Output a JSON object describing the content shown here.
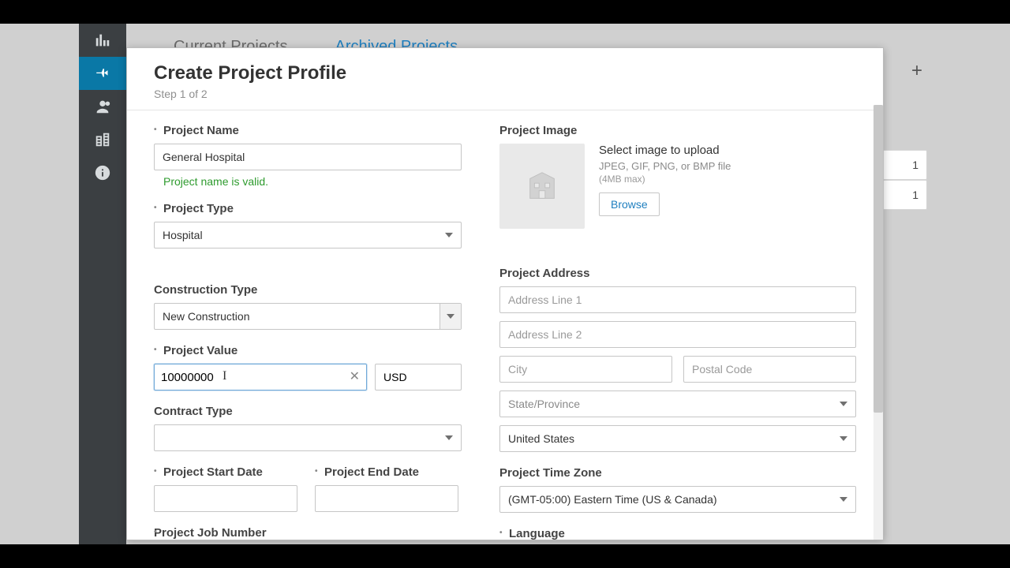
{
  "bg": {
    "tab_current": "Current Projects",
    "tab_archived": "Archived Projects",
    "card1": "1",
    "card2": "1"
  },
  "modal": {
    "title": "Create Project Profile",
    "subtitle": "Step 1 of 2"
  },
  "left": {
    "project_name_label": "Project Name",
    "project_name_value": "General Hospital",
    "project_name_valid": "Project name is valid.",
    "project_type_label": "Project Type",
    "project_type_value": "Hospital",
    "construction_type_label": "Construction Type",
    "construction_type_value": "New Construction",
    "project_value_label": "Project Value",
    "project_value_value": "10000000",
    "project_value_currency": "USD",
    "contract_type_label": "Contract Type",
    "contract_type_value": "",
    "start_date_label": "Project Start Date",
    "end_date_label": "Project End Date",
    "job_number_label": "Project Job Number"
  },
  "right": {
    "project_image_label": "Project Image",
    "image_upload_title": "Select image to upload",
    "image_upload_sub": "JPEG, GIF, PNG, or BMP file",
    "image_upload_sub2": "(4MB max)",
    "browse_label": "Browse",
    "project_address_label": "Project Address",
    "address1_ph": "Address Line 1",
    "address2_ph": "Address Line 2",
    "city_ph": "City",
    "postal_ph": "Postal Code",
    "state_value": "State/Province",
    "country_value": "United States",
    "timezone_label": "Project Time Zone",
    "timezone_value": "(GMT-05:00) Eastern Time (US & Canada)",
    "language_label": "Language"
  }
}
